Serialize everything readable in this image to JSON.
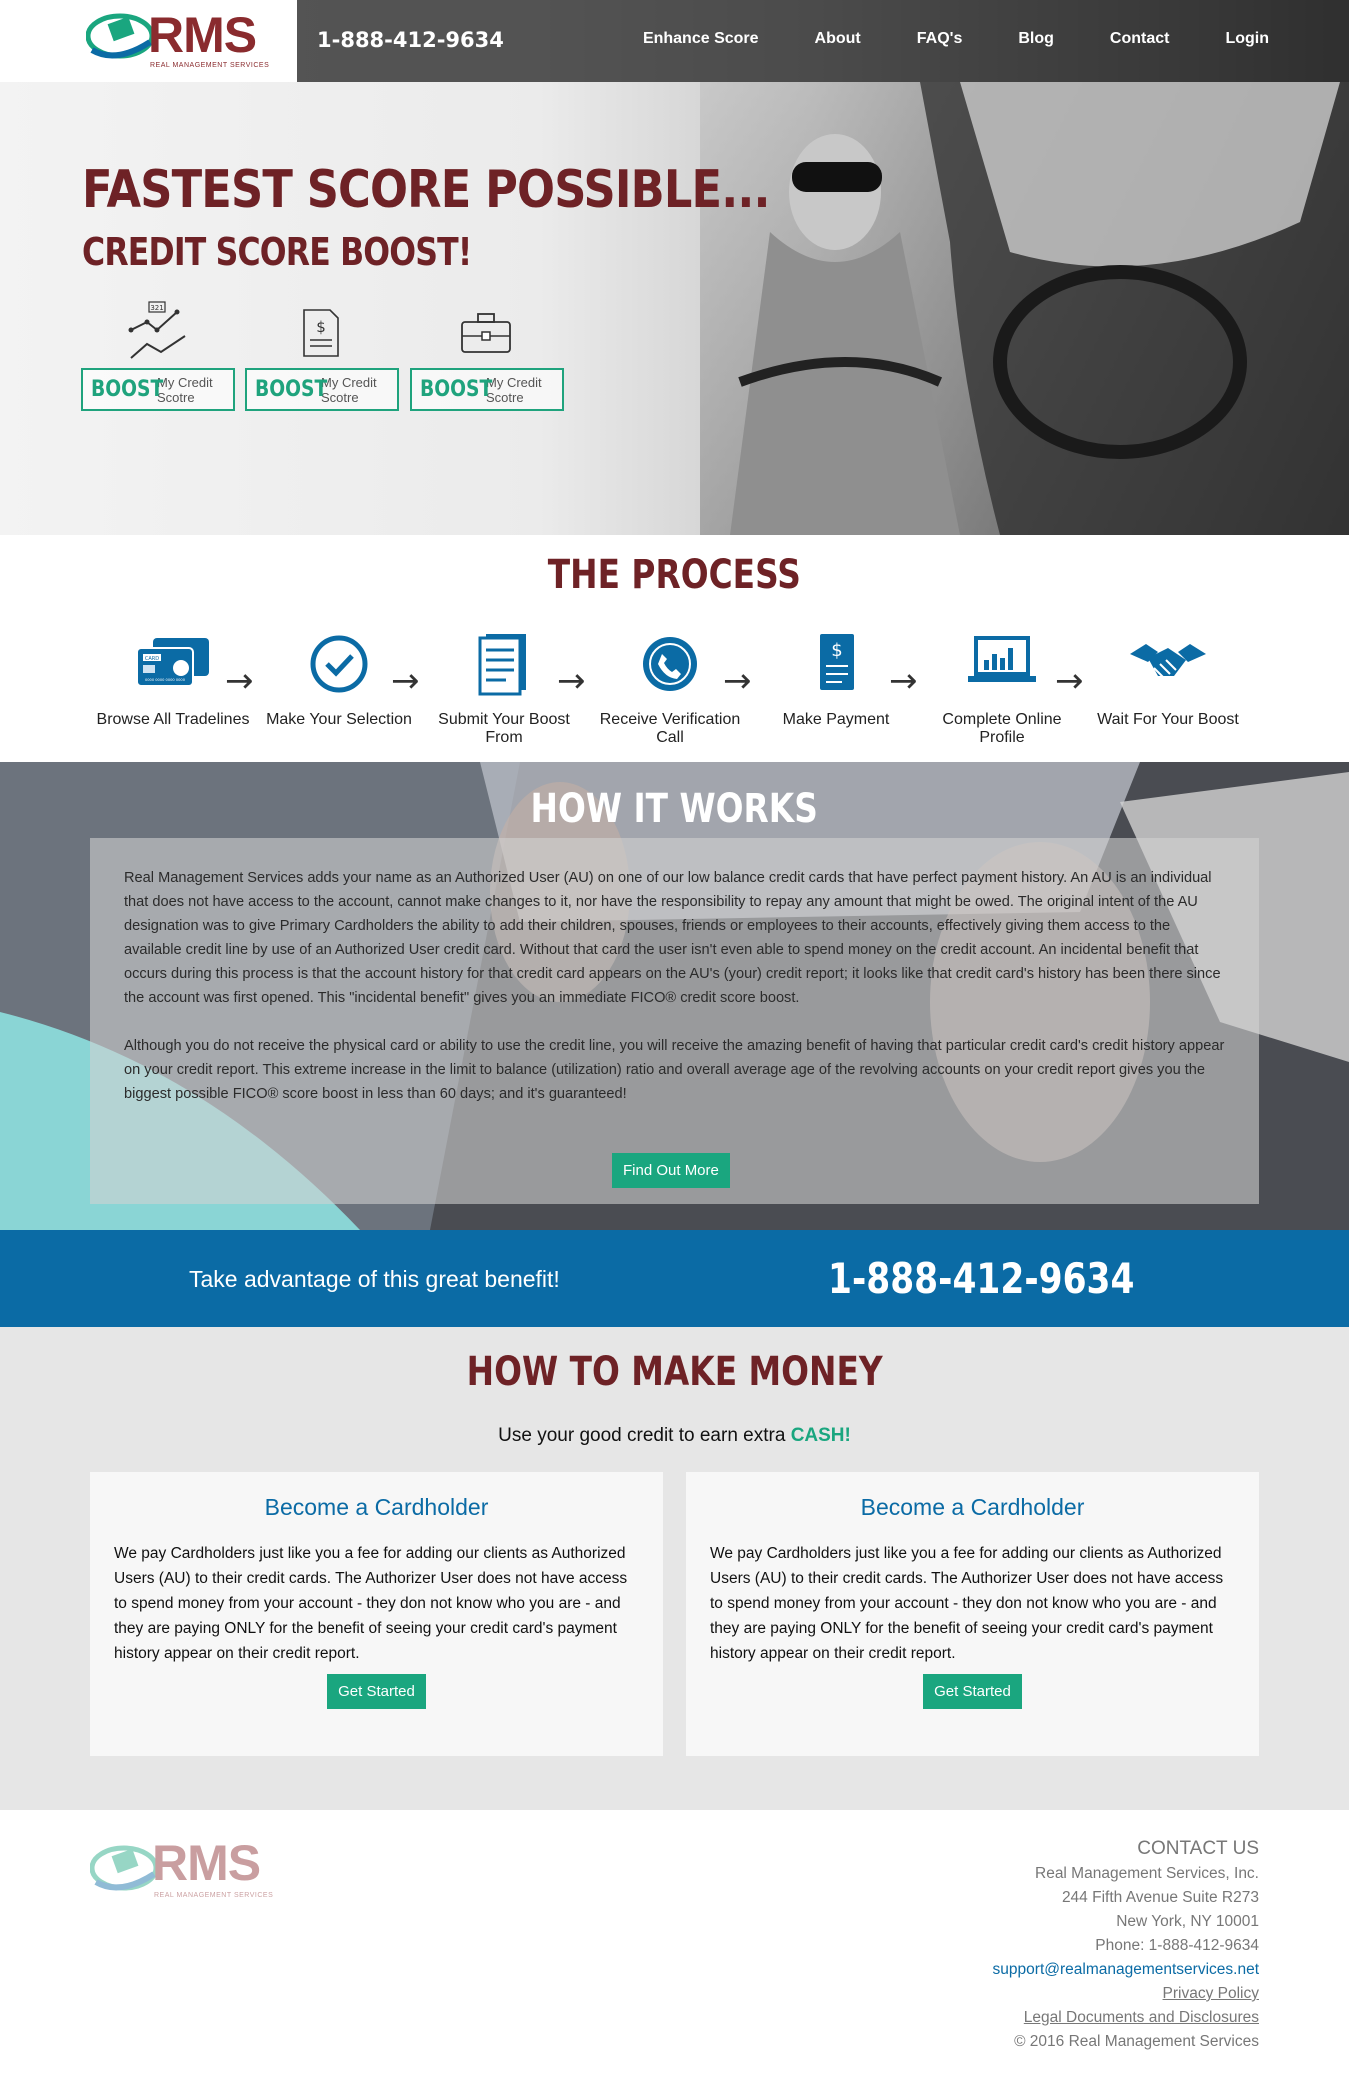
{
  "header": {
    "logo_text": "RMS",
    "logo_sub": "REAL MANAGEMENT SERVICES",
    "phone": "1-888-412-9634",
    "nav": [
      "Enhance Score",
      "About",
      "FAQ's",
      "Blog",
      "Contact",
      "Login"
    ]
  },
  "hero": {
    "title": "FASTEST SCORE POSSIBLE...",
    "subtitle": "CREDIT SCORE BOOST!",
    "chart_icon_number": "321",
    "boost_buttons": [
      {
        "big": "BOOST",
        "small1": "My Credit",
        "small2": "Scotre"
      },
      {
        "big": "BOOST",
        "small1": "My Credit",
        "small2": "Scotre"
      },
      {
        "big": "BOOST",
        "small1": "My Credit",
        "small2": "Scotre"
      }
    ]
  },
  "process": {
    "title": "THE PROCESS",
    "steps": [
      {
        "label": "Browse All Tradelines",
        "icon": "credit-card-icon"
      },
      {
        "label": "Make Your Selection",
        "icon": "checkmark-circle-icon"
      },
      {
        "label": "Submit Your Boost From",
        "icon": "document-icon"
      },
      {
        "label": "Receive Verification Call",
        "icon": "phone-icon"
      },
      {
        "label": "Make Payment",
        "icon": "invoice-dollar-icon"
      },
      {
        "label": "Complete Online Profile",
        "icon": "laptop-chart-icon"
      },
      {
        "label": "Wait For Your Boost",
        "icon": "handshake-icon"
      }
    ],
    "card_text": "CARD",
    "card_number": "0000 0000 0000 0000"
  },
  "how": {
    "title": "HOW IT WORKS",
    "p1": "Real Management Services adds your name as an Authorized User (AU) on one of our low balance credit cards that have perfect payment history. An AU is an individual that does not have access to the account, cannot make changes to it, nor have the responsibility to repay any amount that might be owed. The original intent of the AU designation was to give Primary Cardholders the ability to add their children, spouses, friends or employees to their accounts, effectively giving them access to the available credit line by use of an Authorized User credit card. Without that card the user isn't even able to spend money on the credit account. An incidental benefit that occurs during this process is that the account history for that credit card appears on the AU's (your) credit report; it looks like that credit card's history has been there since the account was first opened. This \"incidental benefit\" gives you an immediate FICO® credit score boost.",
    "p2": "Although you do not receive the physical card or ability to use the credit line, you will receive the amazing benefit of having that particular credit card's credit history appear on your credit report. This extreme increase in the limit to balance (utilization) ratio and overall average age of the revolving accounts on your credit report gives you the biggest possible FICO® score boost in less than 60 days; and it's guaranteed!",
    "button": "Find Out More"
  },
  "cta": {
    "text": "Take advantage of this great benefit!",
    "phone": "1-888-412-9634"
  },
  "money": {
    "title": "HOW TO MAKE MONEY",
    "sub_prefix": "Use your good credit to earn extra ",
    "sub_cash": "CASH!",
    "cards": [
      {
        "title": "Become a Cardholder",
        "text": "We pay Cardholders just like you a fee for adding our clients as Authorized Users (AU) to their credit cards. The Authorizer User does not have access to spend money from your account - they don not know who you are - and they are paying ONLY for the benefit of seeing your credit card's payment history appear on their credit report.",
        "button": "Get Started"
      },
      {
        "title": "Become a Cardholder",
        "text": "We pay Cardholders just like you a fee for adding our clients as Authorized Users (AU) to their credit cards. The Authorizer User does not have access to spend money from your account - they don not know who you are - and they are paying ONLY for the benefit of seeing your credit card's payment history appear on their credit report.",
        "button": "Get Started"
      }
    ]
  },
  "footer": {
    "contact_title": "CONTACT US",
    "company": "Real Management Services, Inc.",
    "address1": "244 Fifth Avenue Suite R273",
    "address2": "New York, NY 10001",
    "phone": "Phone: 1-888-412-9634",
    "email": "support@realmanagementservices.net",
    "privacy": "Privacy Policy",
    "legal": "Legal Documents and Disclosures",
    "copyright": "© 2016 Real Management Services"
  },
  "colors": {
    "brand_maroon": "#6e2226",
    "accent_green": "#1aa67f",
    "brand_blue": "#0b6ba5"
  }
}
